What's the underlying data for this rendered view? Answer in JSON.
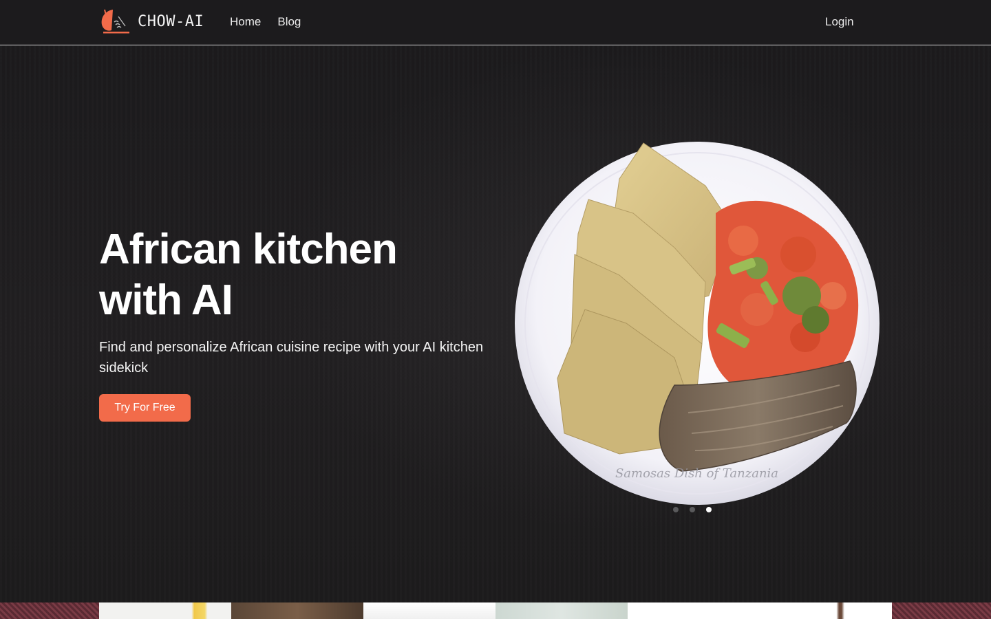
{
  "brand": {
    "name": "CHOW-AI",
    "accent": "#f26b4a"
  },
  "nav": {
    "home": "Home",
    "blog": "Blog",
    "login": "Login"
  },
  "hero": {
    "title_line1": "African kitchen",
    "title_line2": "with AI",
    "subtitle": "Find and personalize African cuisine recipe with your AI kitchen sidekick",
    "cta_label": "Try For Free"
  },
  "carousel": {
    "caption": "Samosas Dish of Tanzania",
    "slide_count": 3,
    "active_index": 2
  }
}
